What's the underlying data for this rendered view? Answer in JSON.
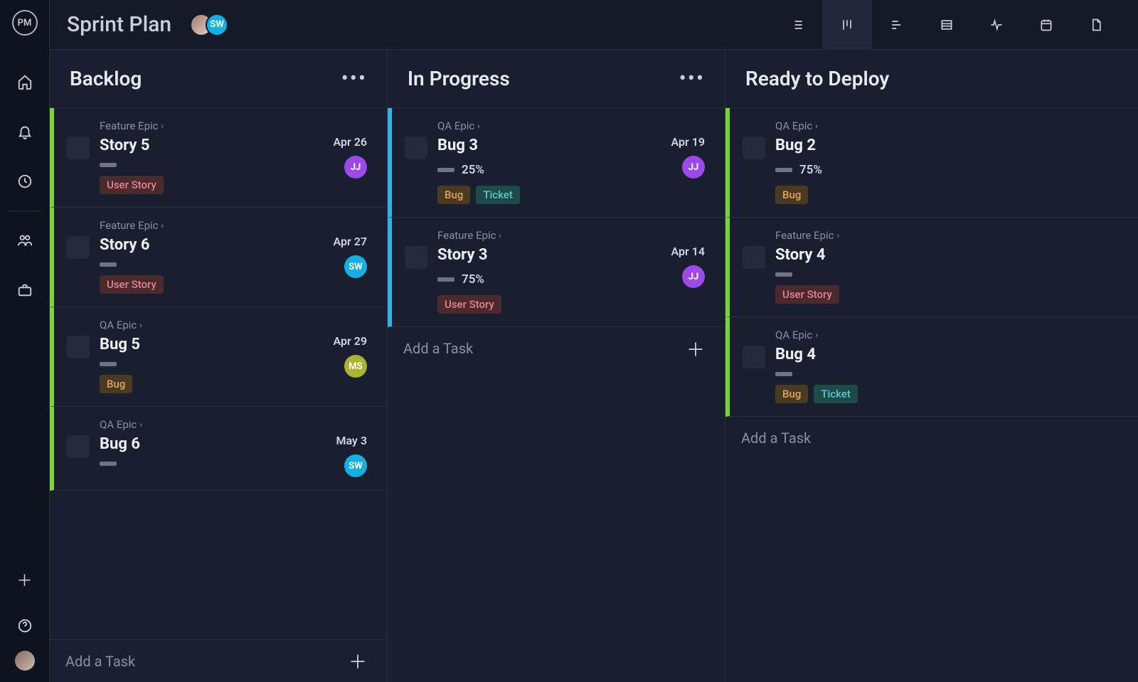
{
  "app": {
    "logo_text": "PM",
    "project_title": "Sprint Plan"
  },
  "header_avatars": [
    {
      "initials": "",
      "bg": "linear-gradient(135deg,#a27d6f,#e2cec1)"
    },
    {
      "initials": "SW",
      "bg": "#14b0e1"
    }
  ],
  "view_tabs": [
    {
      "id": "list",
      "active": false
    },
    {
      "id": "board",
      "active": true
    },
    {
      "id": "gantt",
      "active": false
    },
    {
      "id": "table",
      "active": false
    },
    {
      "id": "pulse",
      "active": false
    },
    {
      "id": "calendar",
      "active": false
    },
    {
      "id": "doc",
      "active": false
    }
  ],
  "add_task_label": "Add a Task",
  "columns": [
    {
      "id": "backlog",
      "title": "Backlog",
      "show_menu": true,
      "show_add_plus": true,
      "cards": [
        {
          "stripe": "green",
          "epic": "Feature Epic",
          "title": "Story 5",
          "percent": "",
          "date": "Apr 26",
          "assignee": {
            "initials": "JJ",
            "bg": "#9b49e8"
          },
          "tags": [
            {
              "text": "User Story",
              "cls": "story"
            }
          ]
        },
        {
          "stripe": "green",
          "epic": "Feature Epic",
          "title": "Story 6",
          "percent": "",
          "date": "Apr 27",
          "assignee": {
            "initials": "SW",
            "bg": "#14b0e1"
          },
          "tags": [
            {
              "text": "User Story",
              "cls": "story"
            }
          ]
        },
        {
          "stripe": "green",
          "epic": "QA Epic",
          "title": "Bug 5",
          "percent": "",
          "date": "Apr 29",
          "assignee": {
            "initials": "MS",
            "bg": "#a8b531"
          },
          "tags": [
            {
              "text": "Bug",
              "cls": "bug"
            }
          ]
        },
        {
          "stripe": "green",
          "epic": "QA Epic",
          "title": "Bug 6",
          "percent": "",
          "date": "May 3",
          "assignee": {
            "initials": "SW",
            "bg": "#14b0e1"
          },
          "tags": []
        }
      ]
    },
    {
      "id": "inprogress",
      "title": "In Progress",
      "show_menu": true,
      "show_add_plus": true,
      "cards": [
        {
          "stripe": "blue",
          "epic": "QA Epic",
          "title": "Bug 3",
          "percent": "25%",
          "date": "Apr 19",
          "assignee": {
            "initials": "JJ",
            "bg": "#9b49e8"
          },
          "tags": [
            {
              "text": "Bug",
              "cls": "bug"
            },
            {
              "text": "Ticket",
              "cls": "ticket"
            }
          ]
        },
        {
          "stripe": "blue",
          "epic": "Feature Epic",
          "title": "Story 3",
          "percent": "75%",
          "date": "Apr 14",
          "assignee": {
            "initials": "JJ",
            "bg": "#9b49e8"
          },
          "tags": [
            {
              "text": "User Story",
              "cls": "story"
            }
          ]
        }
      ]
    },
    {
      "id": "ready",
      "title": "Ready to Deploy",
      "show_menu": false,
      "show_add_plus": false,
      "cards": [
        {
          "stripe": "green",
          "epic": "QA Epic",
          "title": "Bug 2",
          "percent": "75%",
          "date": "",
          "assignee": null,
          "tags": [
            {
              "text": "Bug",
              "cls": "bug"
            }
          ]
        },
        {
          "stripe": "green",
          "epic": "Feature Epic",
          "title": "Story 4",
          "percent": "",
          "date": "",
          "assignee": null,
          "tags": [
            {
              "text": "User Story",
              "cls": "story"
            }
          ]
        },
        {
          "stripe": "green",
          "epic": "QA Epic",
          "title": "Bug 4",
          "percent": "",
          "date": "",
          "assignee": null,
          "tags": [
            {
              "text": "Bug",
              "cls": "bug"
            },
            {
              "text": "Ticket",
              "cls": "ticket"
            }
          ]
        }
      ]
    }
  ]
}
